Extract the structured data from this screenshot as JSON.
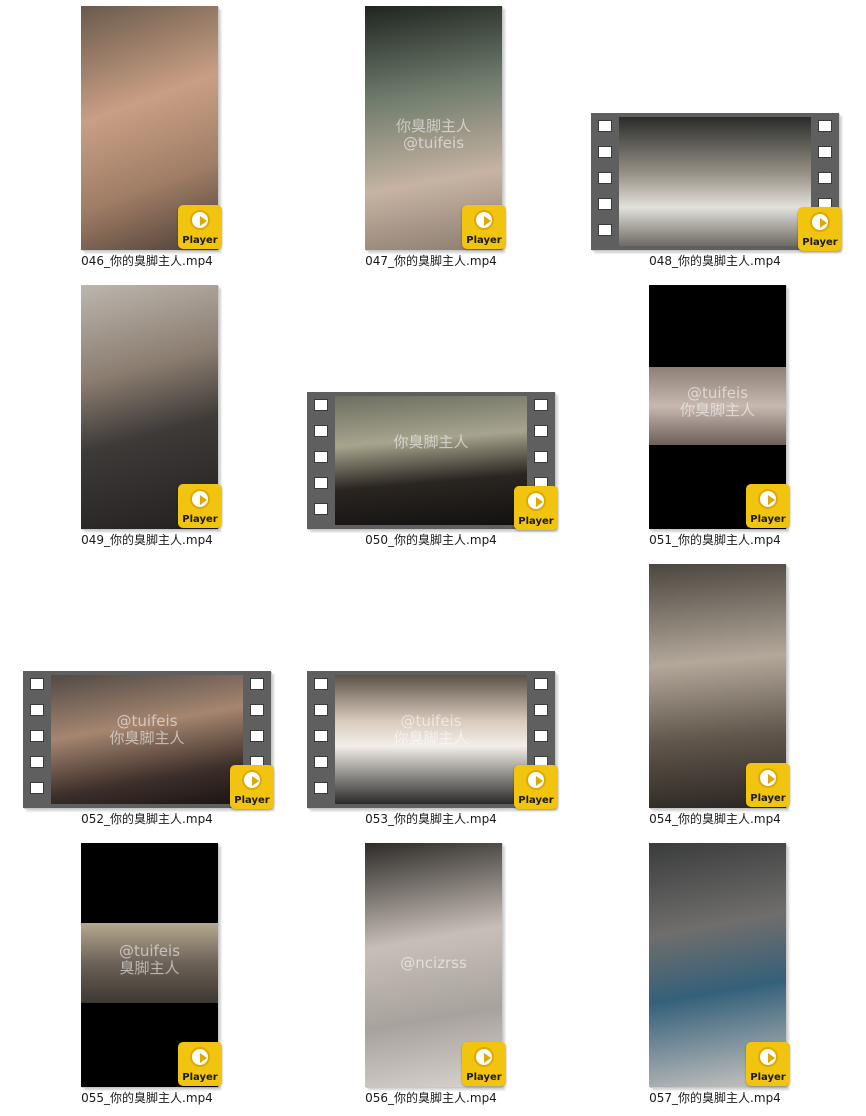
{
  "badge_label": "Player",
  "badge_color": "#f1c40f",
  "items": [
    {
      "name": "046_你的臭脚主人.mp4",
      "layout": "portrait",
      "watermark": ""
    },
    {
      "name": "047_你的臭脚主人.mp4",
      "layout": "portrait",
      "watermark": "你臭脚主人\n@tuifeis"
    },
    {
      "name": "048_你的臭脚主人.mp4",
      "layout": "film",
      "watermark": ""
    },
    {
      "name": "049_你的臭脚主人.mp4",
      "layout": "portrait",
      "watermark": ""
    },
    {
      "name": "050_你的臭脚主人.mp4",
      "layout": "film",
      "watermark": "你臭脚主人"
    },
    {
      "name": "051_你的臭脚主人.mp4",
      "layout": "portrait-letterbox",
      "watermark": "@tuifeis\n你臭脚主人"
    },
    {
      "name": "052_你的臭脚主人.mp4",
      "layout": "film",
      "watermark": "@tuifeis\n你臭脚主人"
    },
    {
      "name": "053_你的臭脚主人.mp4",
      "layout": "film",
      "watermark": "@tuifeis\n你臭脚主人"
    },
    {
      "name": "054_你的臭脚主人.mp4",
      "layout": "portrait",
      "watermark": ""
    },
    {
      "name": "055_你的臭脚主人.mp4",
      "layout": "portrait-letterbox",
      "watermark": "@tuifeis\n臭脚主人"
    },
    {
      "name": "056_你的臭脚主人.mp4",
      "layout": "portrait",
      "watermark": "@ncizrss"
    },
    {
      "name": "057_你的臭脚主人.mp4",
      "layout": "portrait",
      "watermark": ""
    }
  ]
}
